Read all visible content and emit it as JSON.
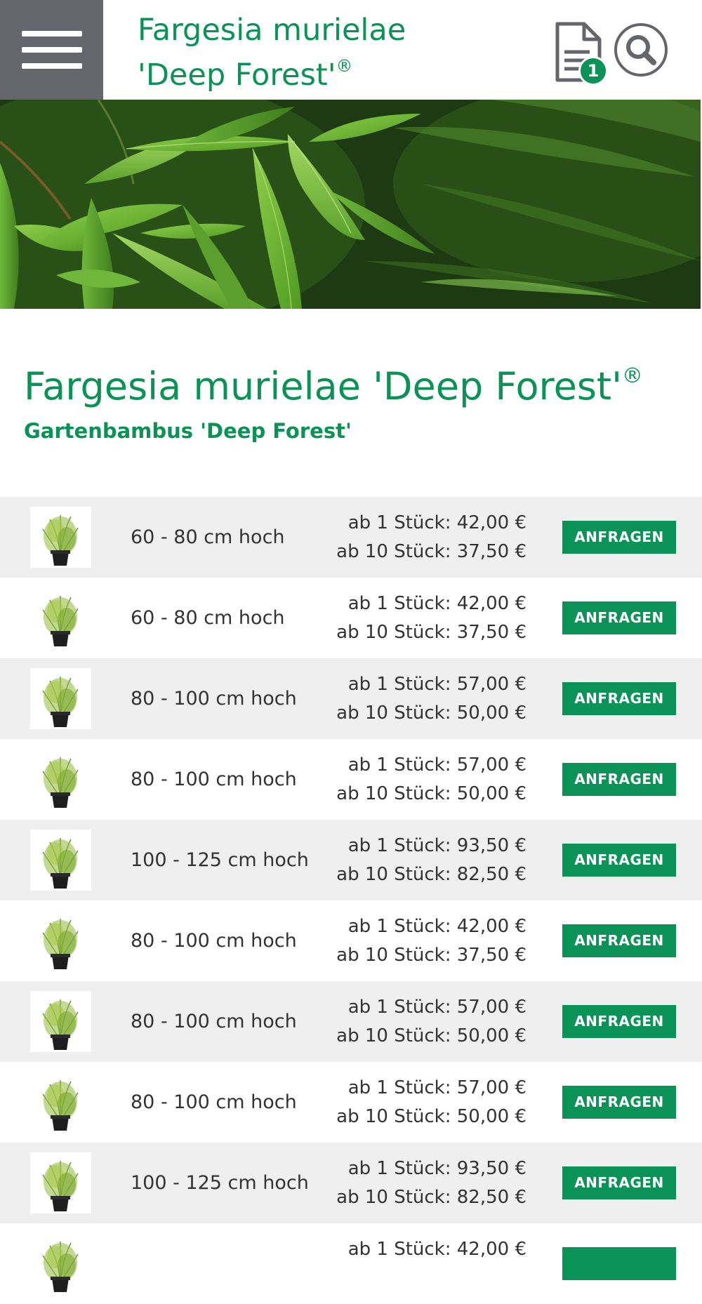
{
  "header": {
    "menu_icon": "hamburger-menu-icon",
    "title_line1": "Fargesia murielae",
    "title_line2": "'Deep Forest'",
    "registered_mark": "®",
    "notes_icon": "document-icon",
    "notes_count": "1",
    "search_icon": "search-icon"
  },
  "hero": {
    "image": "bamboo-leaves-photo"
  },
  "product": {
    "title": "Fargesia murielae 'Deep Forest'",
    "registered_mark": "®",
    "subtitle": "Gartenbambus 'Deep Forest'"
  },
  "rows": [
    {
      "size": "60 - 80 cm hoch",
      "price_1": "ab 1 Stück: 42,00 €",
      "price_10": "ab 10 Stück: 37,50 €",
      "button": "ANFRAGEN"
    },
    {
      "size": "60 - 80 cm hoch",
      "price_1": "ab 1 Stück: 42,00 €",
      "price_10": "ab 10 Stück: 37,50 €",
      "button": "ANFRAGEN"
    },
    {
      "size": "80 - 100 cm hoch",
      "price_1": "ab 1 Stück: 57,00 €",
      "price_10": "ab 10 Stück: 50,00 €",
      "button": "ANFRAGEN"
    },
    {
      "size": "80 - 100 cm hoch",
      "price_1": "ab 1 Stück: 57,00 €",
      "price_10": "ab 10 Stück: 50,00 €",
      "button": "ANFRAGEN"
    },
    {
      "size": "100 - 125 cm hoch",
      "price_1": "ab 1 Stück: 93,50 €",
      "price_10": "ab 10 Stück: 82,50 €",
      "button": "ANFRAGEN"
    },
    {
      "size": "80 - 100 cm hoch",
      "price_1": "ab 1 Stück: 42,00 €",
      "price_10": "ab 10 Stück: 37,50 €",
      "button": "ANFRAGEN"
    },
    {
      "size": "80 - 100 cm hoch",
      "price_1": "ab 1 Stück: 57,00 €",
      "price_10": "ab 10 Stück: 50,00 €",
      "button": "ANFRAGEN"
    },
    {
      "size": "80 - 100 cm hoch",
      "price_1": "ab 1 Stück: 57,00 €",
      "price_10": "ab 10 Stück: 50,00 €",
      "button": "ANFRAGEN"
    },
    {
      "size": "100 - 125 cm hoch",
      "price_1": "ab 1 Stück: 93,50 €",
      "price_10": "ab 10 Stück: 82,50 €",
      "button": "ANFRAGEN"
    },
    {
      "size": "",
      "price_1": "ab 1 Stück: 42,00 €",
      "price_10": "",
      "button": ""
    }
  ],
  "colors": {
    "brand_green": "#0a9257",
    "menu_gray": "#64666b",
    "row_alt": "#efefef"
  }
}
